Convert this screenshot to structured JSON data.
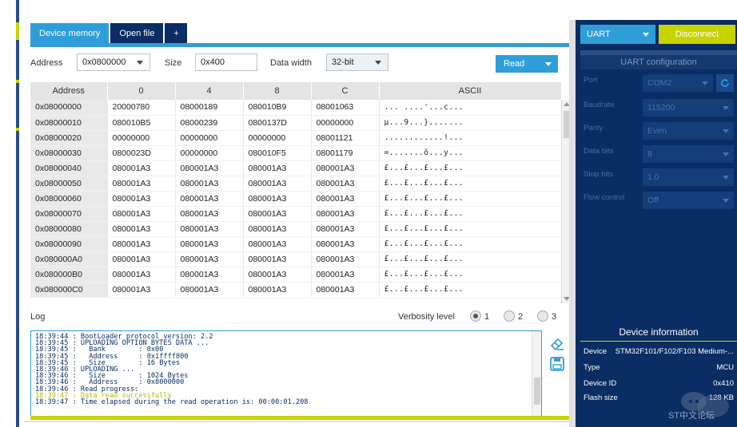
{
  "tabs": [
    {
      "label": "Device memory"
    },
    {
      "label": "Open file"
    },
    {
      "label": "+"
    }
  ],
  "toolbar": {
    "address_label": "Address",
    "address_value": "0x0800000",
    "size_label": "Size",
    "size_value": "0x400",
    "width_label": "Data width",
    "width_value": "32-bit",
    "read_label": "Read"
  },
  "memory_table": {
    "headers": [
      "Address",
      "0",
      "4",
      "8",
      "C",
      "ASCII"
    ],
    "rows": [
      [
        "0x08000000",
        "20000780",
        "08000189",
        "080010B9",
        "08001063",
        "... ....'...c..."
      ],
      [
        "0x08000010",
        "080010B5",
        "08000239",
        "0800137D",
        "00000000",
        "µ...9...}......."
      ],
      [
        "0x08000020",
        "00000000",
        "00000000",
        "00000000",
        "08001121",
        "............!..."
      ],
      [
        "0x08000030",
        "0800023D",
        "00000000",
        "080010F5",
        "08001179",
        "=.......õ...y..."
      ],
      [
        "0x08000040",
        "080001A3",
        "080001A3",
        "080001A3",
        "080001A3",
        "£...£...£...£..."
      ],
      [
        "0x08000050",
        "080001A3",
        "080001A3",
        "080001A3",
        "080001A3",
        "£...£...£...£..."
      ],
      [
        "0x08000060",
        "080001A3",
        "080001A3",
        "080001A3",
        "080001A3",
        "£...£...£...£..."
      ],
      [
        "0x08000070",
        "080001A3",
        "080001A3",
        "080001A3",
        "080001A3",
        "£...£...£...£..."
      ],
      [
        "0x08000080",
        "080001A3",
        "080001A3",
        "080001A3",
        "080001A3",
        "£...£...£...£..."
      ],
      [
        "0x08000090",
        "080001A3",
        "080001A3",
        "080001A3",
        "080001A3",
        "£...£...£...£..."
      ],
      [
        "0x080000A0",
        "080001A3",
        "080001A3",
        "080001A3",
        "080001A3",
        "£...£...£...£..."
      ],
      [
        "0x080000B0",
        "080001A3",
        "080001A3",
        "080001A3",
        "080001A3",
        "£...£...£...£..."
      ],
      [
        "0x080000C0",
        "080001A3",
        "080001A3",
        "080001A3",
        "080001A3",
        "£...£...£...£..."
      ]
    ]
  },
  "log": {
    "title": "Log",
    "verbosity_label": "Verbosity level",
    "verbosity_options": [
      "1",
      "2",
      "3"
    ],
    "verbosity_selected": "1",
    "lines": [
      {
        "text": "18:39:44 : BootLoader protocol version: 2.2",
        "type": "info"
      },
      {
        "text": "18:39:45 : UPLOADING OPTION BYTES DATA ...",
        "type": "info"
      },
      {
        "text": "18:39:45 :   Bank        : 0x00",
        "type": "info"
      },
      {
        "text": "18:39:45 :   Address     : 0x1ffff800",
        "type": "info"
      },
      {
        "text": "18:39:45 :   Size        : 16 Bytes",
        "type": "info"
      },
      {
        "text": "18:39:46 : UPLOADING ...",
        "type": "info"
      },
      {
        "text": "18:39:46 :   Size        : 1024 Bytes",
        "type": "info"
      },
      {
        "text": "18:39:46 :   Address     : 0x8000000",
        "type": "info"
      },
      {
        "text": "18:39:46 : Read progress:",
        "type": "info"
      },
      {
        "text": "18:39:47 : Data read successfully",
        "type": "ok"
      },
      {
        "text": "18:39:47 : Time elapsed during the read operation is: 00:00:01.208",
        "type": "info"
      }
    ]
  },
  "connection": {
    "interface": "UART",
    "disconnect_label": "Disconnect",
    "config_title": "UART configuration",
    "fields": [
      {
        "label": "Port",
        "value": "COM2"
      },
      {
        "label": "Baudrate",
        "value": "115200"
      },
      {
        "label": "Parity",
        "value": "Even"
      },
      {
        "label": "Data bits",
        "value": "8"
      },
      {
        "label": "Stop bits",
        "value": "1.0"
      },
      {
        "label": "Flow control",
        "value": "Off"
      }
    ]
  },
  "device_info": {
    "title": "Device information",
    "rows": [
      {
        "label": "Device",
        "value": "STM32F101/F102/F103 Medium-..."
      },
      {
        "label": "Type",
        "value": "MCU"
      },
      {
        "label": "Device ID",
        "value": "0x410"
      },
      {
        "label": "Flash size",
        "value": "128 KB"
      }
    ]
  },
  "watermark": {
    "text": "ST中文论坛"
  },
  "colors": {
    "accent": "#2f9ed8",
    "navy": "#0a2d63",
    "lime": "#c8d400"
  },
  "icons": {
    "eraser": "eraser-icon",
    "save": "save-icon",
    "refresh": "refresh-icon"
  }
}
